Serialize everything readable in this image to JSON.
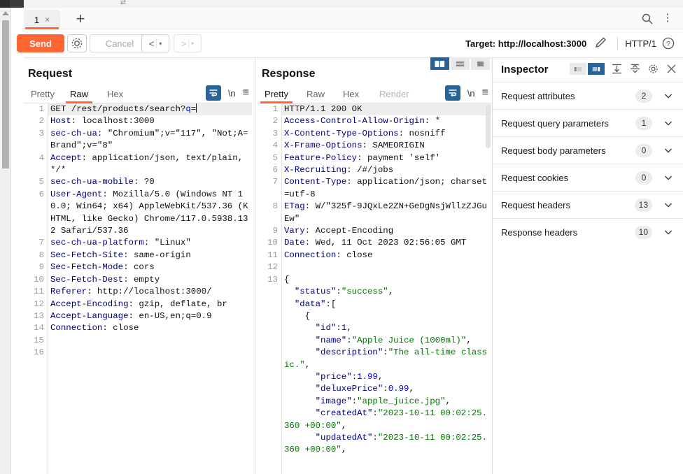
{
  "window": {
    "app": "Burp Suite Repeater"
  },
  "tabbar": {
    "tabs": [
      {
        "label": "1",
        "close": "×",
        "active": true
      }
    ],
    "add_label": "+",
    "search_icon": "search-icon",
    "menu_icon": "kebab-menu-icon"
  },
  "toolbar": {
    "send_label": "Send",
    "settings_icon": "gear-icon",
    "cancel_label": "Cancel",
    "prev_arrow": "<",
    "next_arrow": ">",
    "caret": "▾",
    "target_label": "Target: http://localhost:3000",
    "edit_icon": "pencil-icon",
    "http_version": "HTTP/1",
    "help_icon": "question-circle-icon"
  },
  "request_panel": {
    "title": "Request",
    "tabs": [
      {
        "label": "Pretty",
        "active": false,
        "disabled": false
      },
      {
        "label": "Raw",
        "active": true,
        "disabled": false
      },
      {
        "label": "Hex",
        "active": false,
        "disabled": false
      }
    ],
    "icons": {
      "wrap": "line-wrap-icon",
      "newline": "\\n",
      "menu": "hamburger-menu-icon"
    },
    "lines": [
      {
        "n": "1",
        "highlight": true,
        "parts": [
          {
            "t": "GET /rest/products/search?",
            "c": "plain"
          },
          {
            "t": "q",
            "c": "qp"
          },
          {
            "t": "=",
            "c": "plain"
          },
          {
            "t": "",
            "c": "caret"
          }
        ]
      },
      {
        "n": "2",
        "parts": [
          {
            "t": "Host",
            "c": "hdr"
          },
          {
            "t": ": localhost:3000",
            "c": "plain"
          }
        ]
      },
      {
        "n": "3",
        "parts": [
          {
            "t": "sec-ch-ua",
            "c": "hdr"
          },
          {
            "t": ": \"Chromium\";v=\"117\", \"Not;A=Brand\";v=\"8\"",
            "c": "plain"
          }
        ]
      },
      {
        "n": "4",
        "parts": [
          {
            "t": "Accept",
            "c": "hdr"
          },
          {
            "t": ": application/json, text/plain, */*",
            "c": "plain"
          }
        ]
      },
      {
        "n": "5",
        "parts": [
          {
            "t": "sec-ch-ua-mobile",
            "c": "hdr"
          },
          {
            "t": ": ?0",
            "c": "plain"
          }
        ]
      },
      {
        "n": "6",
        "parts": [
          {
            "t": "User-Agent",
            "c": "hdr"
          },
          {
            "t": ": Mozilla/5.0 (Windows NT 10.0; Win64; x64) AppleWebKit/537.36 (KHTML, like Gecko) Chrome/117.0.5938.132 Safari/537.36",
            "c": "plain"
          }
        ]
      },
      {
        "n": "7",
        "parts": [
          {
            "t": "sec-ch-ua-platform",
            "c": "hdr"
          },
          {
            "t": ": \"Linux\"",
            "c": "plain"
          }
        ]
      },
      {
        "n": "8",
        "parts": [
          {
            "t": "Sec-Fetch-Site",
            "c": "hdr"
          },
          {
            "t": ": same-origin",
            "c": "plain"
          }
        ]
      },
      {
        "n": "9",
        "parts": [
          {
            "t": "Sec-Fetch-Mode",
            "c": "hdr"
          },
          {
            "t": ": cors",
            "c": "plain"
          }
        ]
      },
      {
        "n": "10",
        "parts": [
          {
            "t": "Sec-Fetch-Dest",
            "c": "hdr"
          },
          {
            "t": ": empty",
            "c": "plain"
          }
        ]
      },
      {
        "n": "11",
        "parts": [
          {
            "t": "Referer",
            "c": "hdr"
          },
          {
            "t": ": http://localhost:3000/",
            "c": "plain"
          }
        ]
      },
      {
        "n": "12",
        "parts": [
          {
            "t": "Accept-Encoding",
            "c": "hdr"
          },
          {
            "t": ": gzip, deflate, br",
            "c": "plain"
          }
        ]
      },
      {
        "n": "13",
        "parts": [
          {
            "t": "Accept-Language",
            "c": "hdr"
          },
          {
            "t": ": en-US,en;q=0.9",
            "c": "plain"
          }
        ]
      },
      {
        "n": "14",
        "parts": [
          {
            "t": "Connection",
            "c": "hdr"
          },
          {
            "t": ": close",
            "c": "plain"
          }
        ]
      },
      {
        "n": "15",
        "parts": [
          {
            "t": "",
            "c": "plain"
          }
        ]
      },
      {
        "n": "16",
        "parts": [
          {
            "t": "",
            "c": "plain"
          }
        ]
      }
    ]
  },
  "response_panel": {
    "title": "Response",
    "layout_buttons": [
      {
        "name": "layout-vertical-split",
        "active": true
      },
      {
        "name": "layout-horizontal-split",
        "active": false
      },
      {
        "name": "layout-single-pane",
        "active": false
      }
    ],
    "tabs": [
      {
        "label": "Pretty",
        "active": true,
        "disabled": false
      },
      {
        "label": "Raw",
        "active": false,
        "disabled": false
      },
      {
        "label": "Hex",
        "active": false,
        "disabled": false
      },
      {
        "label": "Render",
        "active": false,
        "disabled": true
      }
    ],
    "icons": {
      "wrap": "line-wrap-icon",
      "newline": "\\n",
      "menu": "hamburger-menu-icon"
    },
    "lines": [
      {
        "n": "1",
        "highlight": true,
        "parts": [
          {
            "t": "HTTP/1.1 200 OK",
            "c": "plain"
          }
        ]
      },
      {
        "n": "2",
        "parts": [
          {
            "t": "Access-Control-Allow-Origin",
            "c": "hdr"
          },
          {
            "t": ": *",
            "c": "plain"
          }
        ]
      },
      {
        "n": "3",
        "parts": [
          {
            "t": "X-Content-Type-Options",
            "c": "hdr"
          },
          {
            "t": ": nosniff",
            "c": "plain"
          }
        ]
      },
      {
        "n": "4",
        "parts": [
          {
            "t": "X-Frame-Options",
            "c": "hdr"
          },
          {
            "t": ": SAMEORIGIN",
            "c": "plain"
          }
        ]
      },
      {
        "n": "5",
        "parts": [
          {
            "t": "Feature-Policy",
            "c": "hdr"
          },
          {
            "t": ": payment 'self'",
            "c": "plain"
          }
        ]
      },
      {
        "n": "6",
        "parts": [
          {
            "t": "X-Recruiting",
            "c": "hdr"
          },
          {
            "t": ": /#/jobs",
            "c": "plain"
          }
        ]
      },
      {
        "n": "7",
        "parts": [
          {
            "t": "Content-Type",
            "c": "hdr"
          },
          {
            "t": ": application/json; charset=utf-8",
            "c": "plain"
          }
        ]
      },
      {
        "n": "8",
        "parts": [
          {
            "t": "ETag",
            "c": "hdr"
          },
          {
            "t": ": W/\"325f-9JQxLe2ZN+GeDgNsjWllzZJGuEw\"",
            "c": "plain"
          }
        ]
      },
      {
        "n": "9",
        "parts": [
          {
            "t": "Vary",
            "c": "hdr"
          },
          {
            "t": ": Accept-Encoding",
            "c": "plain"
          }
        ]
      },
      {
        "n": "10",
        "parts": [
          {
            "t": "Date",
            "c": "hdr"
          },
          {
            "t": ": Wed, 11 Oct 2023 02:56:05 GMT",
            "c": "plain"
          }
        ]
      },
      {
        "n": "11",
        "parts": [
          {
            "t": "Connection",
            "c": "hdr"
          },
          {
            "t": ": close",
            "c": "plain"
          }
        ]
      },
      {
        "n": "12",
        "parts": [
          {
            "t": "",
            "c": "plain"
          }
        ]
      },
      {
        "n": "13",
        "parts": [
          {
            "t": "{",
            "c": "plain"
          }
        ]
      },
      {
        "n": "",
        "parts": [
          {
            "t": "  \"status\"",
            "c": "jkey"
          },
          {
            "t": ":",
            "c": "plain"
          },
          {
            "t": "\"success\"",
            "c": "jstr"
          },
          {
            "t": ",",
            "c": "plain"
          }
        ]
      },
      {
        "n": "",
        "parts": [
          {
            "t": "  \"data\"",
            "c": "jkey"
          },
          {
            "t": ":[",
            "c": "plain"
          }
        ]
      },
      {
        "n": "",
        "parts": [
          {
            "t": "    {",
            "c": "plain"
          }
        ]
      },
      {
        "n": "",
        "parts": [
          {
            "t": "      \"id\"",
            "c": "jkey"
          },
          {
            "t": ":",
            "c": "plain"
          },
          {
            "t": "1",
            "c": "jnum"
          },
          {
            "t": ",",
            "c": "plain"
          }
        ]
      },
      {
        "n": "",
        "parts": [
          {
            "t": "      \"name\"",
            "c": "jkey"
          },
          {
            "t": ":",
            "c": "plain"
          },
          {
            "t": "\"Apple Juice (1000ml)\"",
            "c": "jstr"
          },
          {
            "t": ",",
            "c": "plain"
          }
        ]
      },
      {
        "n": "",
        "parts": [
          {
            "t": "      \"description\"",
            "c": "jkey"
          },
          {
            "t": ":",
            "c": "plain"
          },
          {
            "t": "\"The all-time classic.\"",
            "c": "jstr"
          },
          {
            "t": ",",
            "c": "plain"
          }
        ]
      },
      {
        "n": "",
        "parts": [
          {
            "t": "      \"price\"",
            "c": "jkey"
          },
          {
            "t": ":",
            "c": "plain"
          },
          {
            "t": "1.99",
            "c": "jnum"
          },
          {
            "t": ",",
            "c": "plain"
          }
        ]
      },
      {
        "n": "",
        "parts": [
          {
            "t": "      \"deluxePrice\"",
            "c": "jkey"
          },
          {
            "t": ":",
            "c": "plain"
          },
          {
            "t": "0.99",
            "c": "jnum"
          },
          {
            "t": ",",
            "c": "plain"
          }
        ]
      },
      {
        "n": "",
        "parts": [
          {
            "t": "      \"image\"",
            "c": "jkey"
          },
          {
            "t": ":",
            "c": "plain"
          },
          {
            "t": "\"apple_juice.jpg\"",
            "c": "jstr"
          },
          {
            "t": ",",
            "c": "plain"
          }
        ]
      },
      {
        "n": "",
        "parts": [
          {
            "t": "      \"createdAt\"",
            "c": "jkey"
          },
          {
            "t": ":",
            "c": "plain"
          },
          {
            "t": "\"2023-10-11 00:02:25.360 +00:00\"",
            "c": "jstr"
          },
          {
            "t": ",",
            "c": "plain"
          }
        ]
      },
      {
        "n": "",
        "parts": [
          {
            "t": "      \"updatedAt\"",
            "c": "jkey"
          },
          {
            "t": ":",
            "c": "plain"
          },
          {
            "t": "\"2023-10-11 00:02:25.360 +00:00\"",
            "c": "jstr"
          },
          {
            "t": ",",
            "c": "plain"
          }
        ]
      }
    ],
    "scrollbar": "response-vertical-scrollbar"
  },
  "inspector": {
    "title": "Inspector",
    "layout_buttons": [
      {
        "name": "inspector-dock-left",
        "active": false
      },
      {
        "name": "inspector-dock-right",
        "active": true
      }
    ],
    "expand_all_icon": "expand-all-icon",
    "collapse_all_icon": "collapse-all-icon",
    "settings_icon": "gear-icon",
    "close_icon": "close-icon",
    "sections": [
      {
        "label": "Request attributes",
        "count": "2"
      },
      {
        "label": "Request query parameters",
        "count": "1"
      },
      {
        "label": "Request body parameters",
        "count": "0"
      },
      {
        "label": "Request cookies",
        "count": "0"
      },
      {
        "label": "Request headers",
        "count": "13"
      },
      {
        "label": "Response headers",
        "count": "10"
      }
    ]
  },
  "colors": {
    "accent": "#ff6633",
    "toggle_active": "#2a6496",
    "header_blue": "#000080",
    "json_string_green": "#007700",
    "json_number_blue": "#0000cc"
  }
}
